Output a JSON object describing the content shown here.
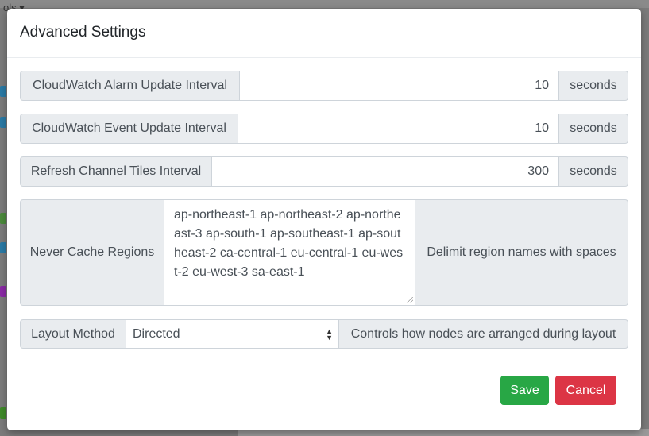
{
  "background": {
    "tools_label": "ols ▾"
  },
  "modal": {
    "title": "Advanced Settings",
    "fields": {
      "alarm": {
        "label": "CloudWatch Alarm Update Interval",
        "value": "10",
        "unit": "seconds"
      },
      "event": {
        "label": "CloudWatch Event Update Interval",
        "value": "10",
        "unit": "seconds"
      },
      "tiles": {
        "label": "Refresh Channel Tiles Interval",
        "value": "300",
        "unit": "seconds"
      },
      "regions": {
        "label": "Never Cache Regions",
        "value": "ap-northeast-1 ap-northeast-2 ap-northeast-3 ap-south-1 ap-southeast-1 ap-southeast-2 ca-central-1 eu-central-1 eu-west-2 eu-west-3 sa-east-1",
        "hint": "Delimit region names with spaces"
      },
      "layout": {
        "label": "Layout Method",
        "selected": "Directed",
        "hint": "Controls how nodes are arranged during layout"
      }
    },
    "buttons": {
      "save": "Save",
      "cancel": "Cancel"
    }
  },
  "colors": {
    "save": "#28a745",
    "cancel": "#dc3545",
    "addon_bg": "#e9ecef",
    "border": "#ced4da"
  }
}
